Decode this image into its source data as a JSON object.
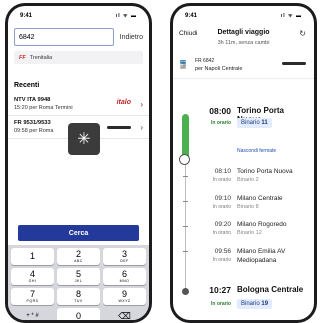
{
  "left": {
    "status_time": "9:41",
    "status_icons": "ıl ᯤ ▬",
    "search_value": "6842",
    "cancel_label": "Indietro",
    "filter_chip": {
      "logo": "FF",
      "label": "Trenitalia"
    },
    "recent_title": "Recenti",
    "recent_items": [
      {
        "line1": "NTV ITA 9948",
        "line2": "15:20 per Roma Termini",
        "brand": "italo"
      },
      {
        "line1": "FR 9531/9533",
        "line2": "09:58 per Roma",
        "brand": ""
      }
    ],
    "search_button": "Cerca",
    "keypad": [
      [
        {
          "d": "1",
          "s": ""
        },
        {
          "d": "2",
          "s": "ABC"
        },
        {
          "d": "3",
          "s": "DEF"
        }
      ],
      [
        {
          "d": "4",
          "s": "GHI"
        },
        {
          "d": "5",
          "s": "JKL"
        },
        {
          "d": "6",
          "s": "MNO"
        }
      ],
      [
        {
          "d": "7",
          "s": "PQRS"
        },
        {
          "d": "8",
          "s": "TUV"
        },
        {
          "d": "9",
          "s": "WXYZ"
        }
      ],
      [
        {
          "d": "+ * #",
          "s": ""
        },
        {
          "d": "0",
          "s": ""
        },
        {
          "d": "⌫",
          "s": ""
        }
      ]
    ]
  },
  "right": {
    "status_time": "9:41",
    "status_icons": "ıl ᯤ ▬",
    "close_label": "Chiudi",
    "title": "Dettagli viaggio",
    "subtitle": "3h 11m, senza cambi",
    "train_number": "FR 6842",
    "train_direction": "per Napoli Centrale",
    "hidden_stops_link": "Nascondi fermate",
    "stops": [
      {
        "time": "08:00",
        "status": "In orario",
        "station": "Torino Porta Nuova",
        "platform_prefix": "Binario",
        "platform_num": "11",
        "major": true
      },
      {
        "time": "08:10",
        "status": "In orario",
        "station": "Torino Porta Nuova",
        "platform": "Binario 2",
        "major": false
      },
      {
        "time": "09:10",
        "status": "In orario",
        "station": "Milano Centrale",
        "platform": "Binario 8",
        "major": false
      },
      {
        "time": "09:20",
        "status": "In orario",
        "station": "Milano Rogoredo",
        "platform": "Binario 12",
        "major": false
      },
      {
        "time": "09:56",
        "status": "In orario",
        "station": "Milano Emilia AV",
        "platform": "Mediopadana",
        "major": false
      },
      {
        "time": "10:27",
        "status": "In orario",
        "station": "Bologna Centrale",
        "platform_prefix": "Binario",
        "platform_num": "19",
        "major": true
      }
    ]
  }
}
